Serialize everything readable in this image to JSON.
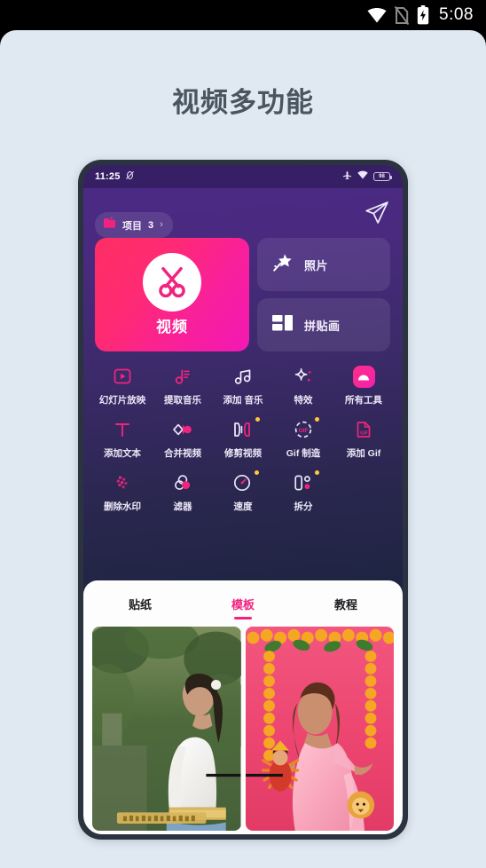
{
  "os_status": {
    "time": "5:08",
    "icons": [
      "wifi-icon",
      "sim-off-icon",
      "battery-charging-icon"
    ]
  },
  "page": {
    "title": "视频多功能",
    "background_color": "#e0e9f1",
    "title_color": "#4a5560"
  },
  "phone": {
    "status_bar": {
      "time": "11:25",
      "mute_icon": "do-not-disturb-icon",
      "airplane_icon": "airplane-mode-icon",
      "wifi_icon": "wifi-icon",
      "battery_level": "98"
    },
    "app": {
      "accent_color": "#f0247f",
      "header": {
        "project_label": "项目",
        "project_count": "3",
        "chevron": "›",
        "send_icon": "send-plane-icon"
      },
      "cards": {
        "video": {
          "label": "视频",
          "icon": "scissors-icon"
        },
        "photo": {
          "label": "照片",
          "icon": "magic-wand-icon"
        },
        "collage": {
          "label": "拼贴画",
          "icon": "collage-grid-icon"
        }
      },
      "tool_rows": [
        [
          {
            "label": "幻灯片放映",
            "icon": "slideshow-play-icon",
            "badge": false
          },
          {
            "label": "提取音乐",
            "icon": "extract-music-icon",
            "badge": false
          },
          {
            "label": "添加 音乐",
            "icon": "add-music-note-icon",
            "badge": false
          },
          {
            "label": "特效",
            "icon": "sparkle-effects-icon",
            "badge": false
          },
          {
            "label": "所有工具",
            "icon": "all-tools-icon",
            "badge": false
          }
        ],
        [
          {
            "label": "添加文本",
            "icon": "text-t-icon",
            "badge": false
          },
          {
            "label": "合并视频",
            "icon": "merge-video-icon",
            "badge": false
          },
          {
            "label": "修剪视频",
            "icon": "trim-video-icon",
            "badge": true
          },
          {
            "label": "Gif 制造",
            "icon": "gif-make-icon",
            "badge": true
          },
          {
            "label": "添加 Gif",
            "icon": "add-gif-icon",
            "badge": false
          }
        ],
        [
          {
            "label": "删除水印",
            "icon": "remove-watermark-icon",
            "badge": false
          },
          {
            "label": "滤器",
            "icon": "filter-circles-icon",
            "badge": false
          },
          {
            "label": "速度",
            "icon": "speed-gauge-icon",
            "badge": true
          },
          {
            "label": "拆分",
            "icon": "split-icon",
            "badge": true
          }
        ]
      ],
      "sheet": {
        "tabs": [
          {
            "label": "贴纸",
            "active": false
          },
          {
            "label": "模板",
            "active": true
          },
          {
            "label": "教程",
            "active": false
          }
        ],
        "thumbnails": [
          {
            "name": "template-garden-portrait"
          },
          {
            "name": "template-pink-saree-marigold"
          }
        ]
      },
      "nav_bar": {
        "menu_icon": "hamburger-menu-icon",
        "home_icon": "home-dot-icon",
        "recents_icon": "square-recents-icon",
        "back_icon": "back-chevron-icon"
      }
    }
  }
}
